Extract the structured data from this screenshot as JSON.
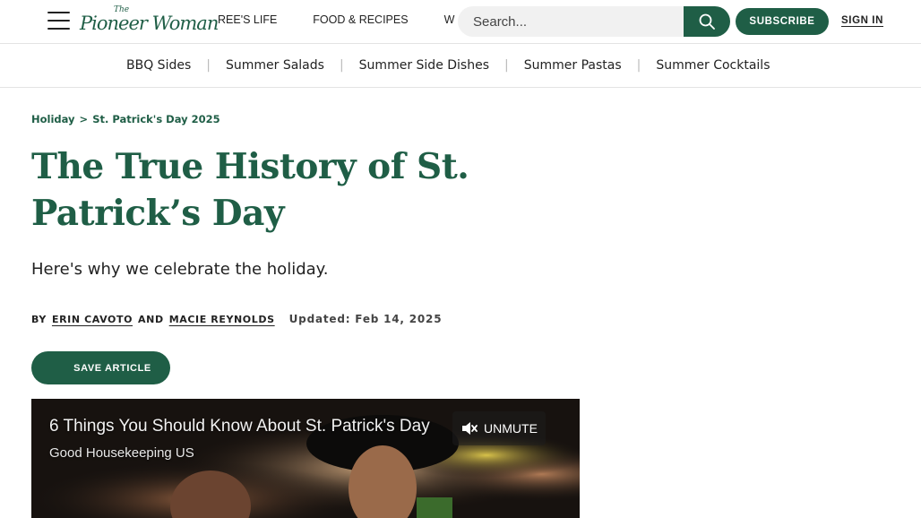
{
  "header": {
    "logo_the": "The",
    "logo_name": "Pioneer Woman",
    "nav": [
      "REE'S LIFE",
      "FOOD & RECIPES",
      "W"
    ],
    "search_placeholder": "Search...",
    "subscribe_label": "SUBSCRIBE",
    "signin_label": "SIGN IN"
  },
  "subnav": {
    "items": [
      "BBQ Sides",
      "Summer Salads",
      "Summer Side Dishes",
      "Summer Pastas",
      "Summer Cocktails"
    ],
    "separator": "|"
  },
  "breadcrumb": {
    "parent": "Holiday",
    "separator": ">",
    "current": "St. Patrick's Day 2025"
  },
  "article": {
    "title": "The True History of St. Patrick’s Day",
    "dek": "Here's why we celebrate the holiday.",
    "by_label": "BY",
    "author_1": "ERIN CAVOTO",
    "and_label": "AND",
    "author_2": "MACIE REYNOLDS",
    "updated": "Updated: Feb 14, 2025",
    "save_label": "SAVE ARTICLE"
  },
  "video": {
    "title": "6 Things You Should Know About St. Patrick's Day",
    "source": "Good Housekeeping US",
    "unmute_label": "UNMUTE"
  },
  "colors": {
    "brand_green": "#1f5e46",
    "text": "#222222",
    "divider": "#e3e3e3"
  },
  "icons": {
    "menu": "hamburger-icon",
    "search": "search-icon",
    "mute": "speaker-muted-icon",
    "bookmark": "bookmark-icon"
  }
}
